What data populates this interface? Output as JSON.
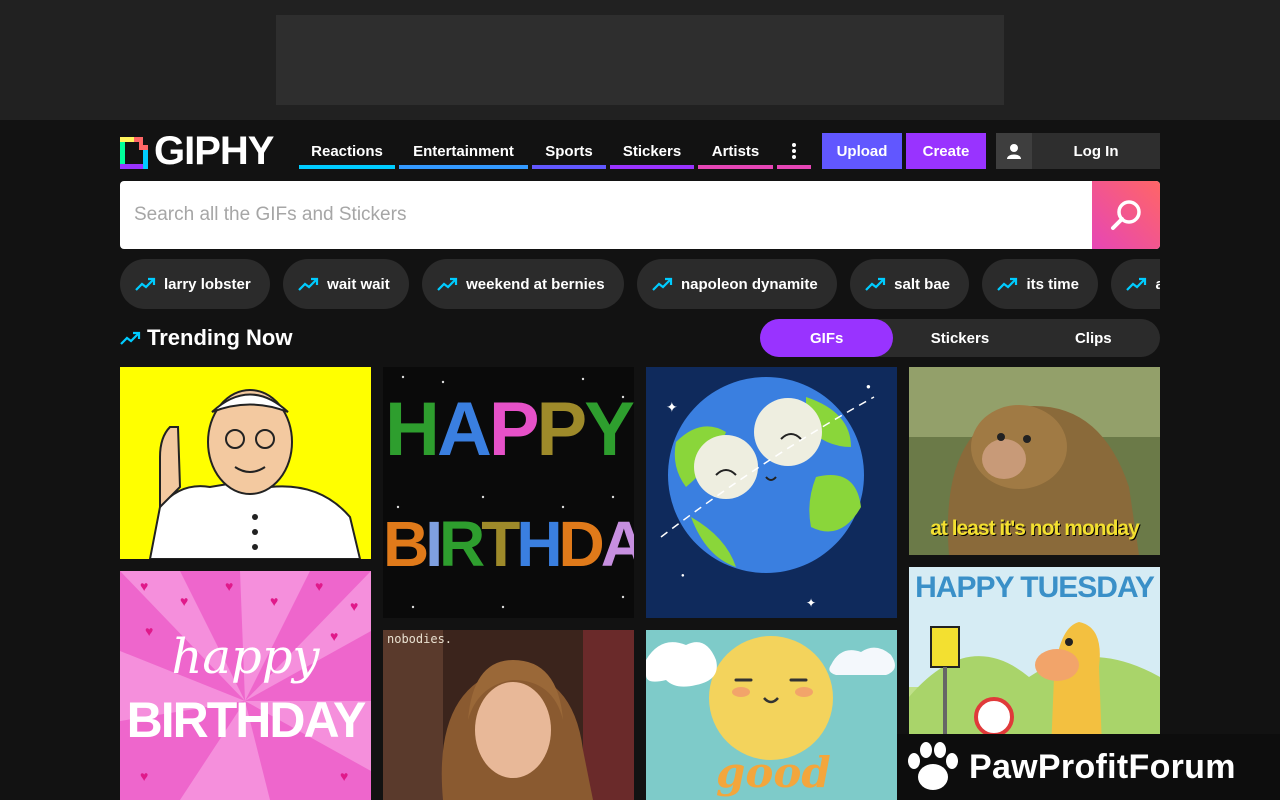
{
  "ad": {},
  "logo": {
    "text": "GIPHY"
  },
  "nav": {
    "items": [
      {
        "label": "Reactions",
        "color": "#00ccff"
      },
      {
        "label": "Entertainment",
        "color": "#3399ff"
      },
      {
        "label": "Sports",
        "color": "#6157ff"
      },
      {
        "label": "Stickers",
        "color": "#9933ff"
      },
      {
        "label": "Artists",
        "color": "#e646b6"
      }
    ],
    "more_icon": "more-vertical-icon",
    "more_color": "#e646b6"
  },
  "actions": {
    "upload": "Upload",
    "create": "Create",
    "login": "Log In"
  },
  "search": {
    "placeholder": "Search all the GIFs and Stickers",
    "value": ""
  },
  "trending_searches": [
    "larry lobster",
    "wait wait",
    "weekend at bernies",
    "napoleon dynamite",
    "salt bae",
    "its time",
    "actually"
  ],
  "section": {
    "title": "Trending Now"
  },
  "content_toggle": {
    "items": [
      "GIFs",
      "Stickers",
      "Clips"
    ],
    "active": "GIFs"
  },
  "gifs": {
    "monkey_caption": "at least it's not monday",
    "tuesday_caption": "HAPPY TUESDAY",
    "birthday_top": "HAPPY",
    "birthday_bottom": "BIRTHDAY",
    "pink_script": "happy",
    "pink_block": "BIRTHDAY",
    "nobodies": "nobodies.",
    "good_text": "good"
  },
  "watermark": {
    "text": "PawProfitForum"
  },
  "colors": {
    "accent_purple": "#9933ff",
    "upload_blue": "#6157ff",
    "search_pink": "#e646b6",
    "trend_cyan": "#00ccff"
  }
}
